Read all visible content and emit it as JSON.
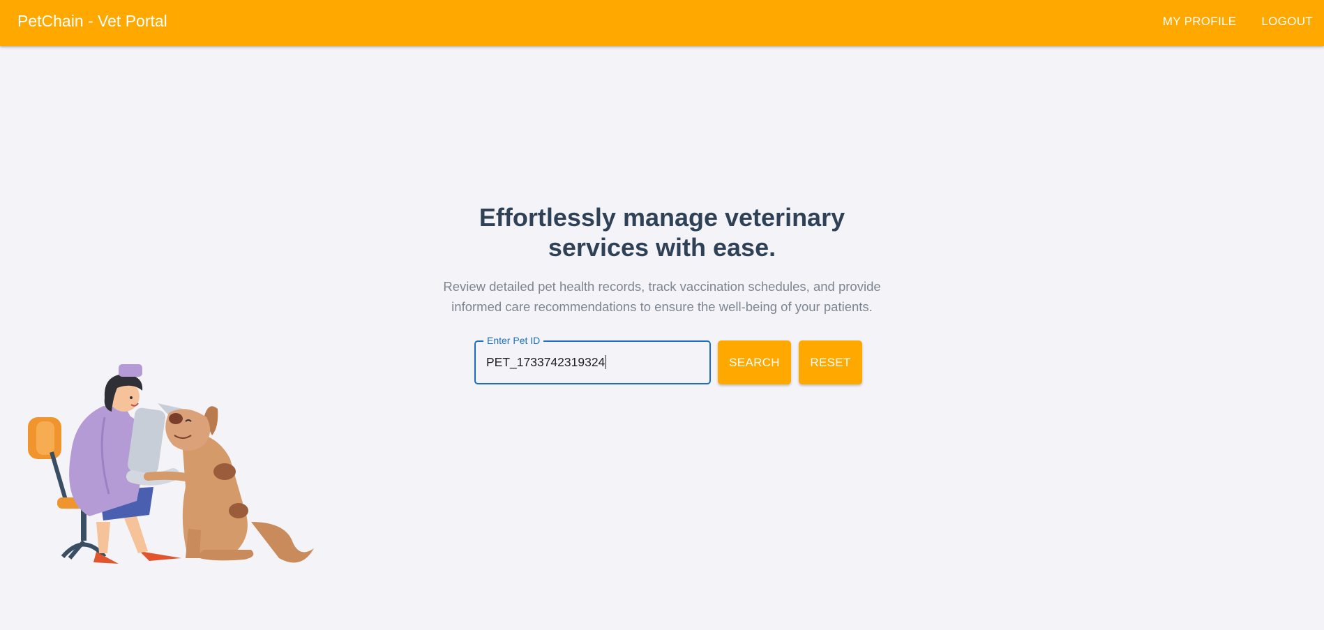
{
  "header": {
    "title": "PetChain - Vet Portal",
    "nav": {
      "profile_label": "MY PROFILE",
      "logout_label": "LOGOUT"
    }
  },
  "hero": {
    "headline_line1": "Effortlessly manage veterinary",
    "headline_line2": "services with ease.",
    "description_line1": "Review detailed pet health records, track vaccination schedules, and provide",
    "description_line2": "informed care recommendations to ensure the well-being of your patients."
  },
  "search": {
    "label": "Enter Pet ID",
    "value": "PET_1733742319324",
    "search_label": "SEARCH",
    "reset_label": "RESET"
  },
  "colors": {
    "primary": "#ffa800",
    "focus": "#1a6fc3",
    "heading": "#2e4156",
    "body_text": "#7c8590",
    "background": "#f4f4f8"
  },
  "illustration": {
    "name": "vet-bandaging-dog-illustration"
  }
}
